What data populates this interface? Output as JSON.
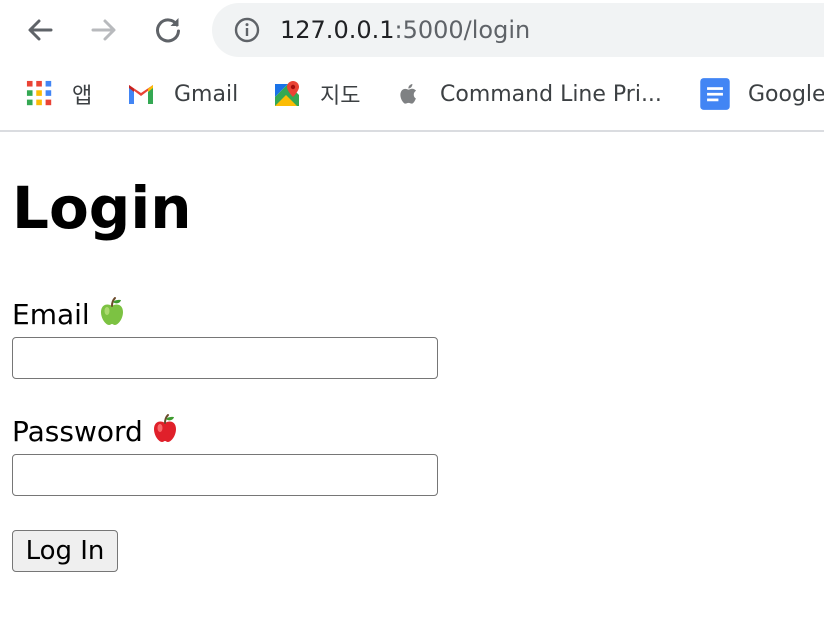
{
  "browser": {
    "url_host": "127.0.0.1",
    "url_path": ":5000/login"
  },
  "bookmarks": [
    {
      "label": "앱",
      "icon": "apps-grid-icon"
    },
    {
      "label": "Gmail",
      "icon": "gmail-icon"
    },
    {
      "label": "지도",
      "icon": "maps-icon"
    },
    {
      "label": "Command Line Pri...",
      "icon": "apple-icon"
    },
    {
      "label": "Google",
      "icon": "google-docs-icon"
    }
  ],
  "page": {
    "title": "Login",
    "email_label": "Email",
    "email_emoji": "green-apple",
    "email_value": "",
    "password_label": "Password",
    "password_emoji": "red-apple",
    "password_value": "",
    "submit_label": "Log In"
  },
  "colors": {
    "omnibox_bg": "#f1f3f4",
    "url_host": "#202124",
    "url_path": "#5f6368",
    "input_border": "#767676",
    "button_bg": "#efefef"
  }
}
